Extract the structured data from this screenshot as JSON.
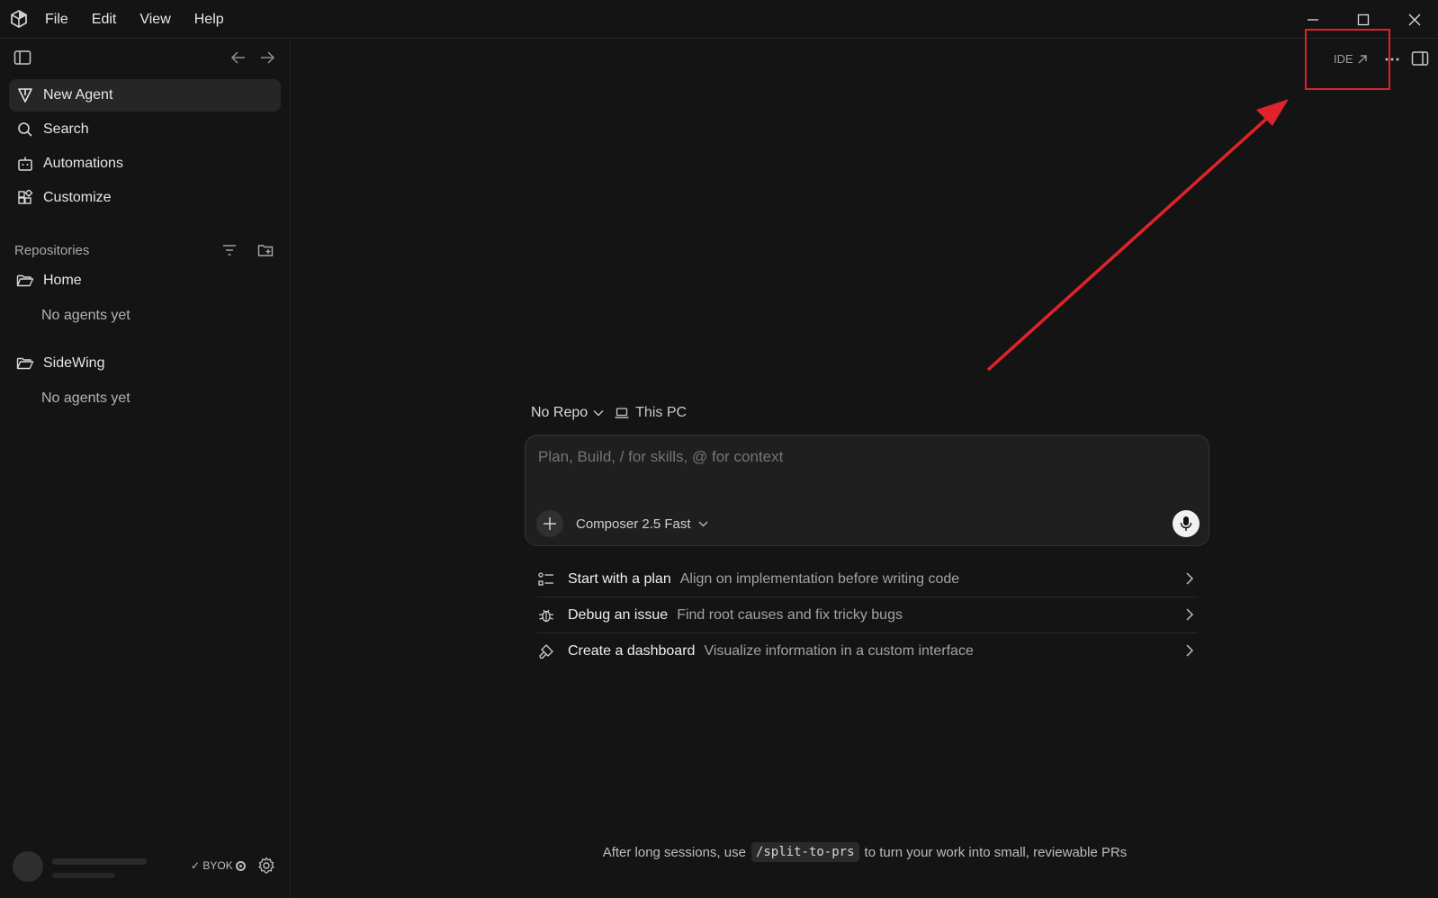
{
  "menu": {
    "items": [
      "File",
      "Edit",
      "View",
      "Help"
    ]
  },
  "sidebar": {
    "nav": [
      {
        "label": "New Agent",
        "icon": "new-agent-icon",
        "active": true
      },
      {
        "label": "Search",
        "icon": "search-icon"
      },
      {
        "label": "Automations",
        "icon": "robot-icon"
      },
      {
        "label": "Customize",
        "icon": "blocks-icon"
      }
    ],
    "section_label": "Repositories",
    "repos": [
      {
        "name": "Home",
        "empty_note": "No agents yet"
      },
      {
        "name": "SideWing",
        "empty_note": "No agents yet"
      }
    ],
    "byok_label": "✓ BYOK"
  },
  "header": {
    "ide_label": "IDE"
  },
  "composer": {
    "repo_label": "No Repo",
    "location_label": "This PC",
    "placeholder": "Plan, Build, / for skills, @ for context",
    "model_label": "Composer 2.5 Fast"
  },
  "suggestions": [
    {
      "title": "Start with a plan",
      "desc": "Align on implementation before writing code",
      "icon": "plan-list-icon"
    },
    {
      "title": "Debug an issue",
      "desc": "Find root causes and fix tricky bugs",
      "icon": "bug-icon"
    },
    {
      "title": "Create a dashboard",
      "desc": "Visualize information in a custom interface",
      "icon": "brush-icon"
    }
  ],
  "tip": {
    "before": "After long sessions, use",
    "command": "/split-to-prs",
    "after": "to turn your work into small, reviewable PRs"
  },
  "annotation": {
    "color": "#e0232a"
  }
}
